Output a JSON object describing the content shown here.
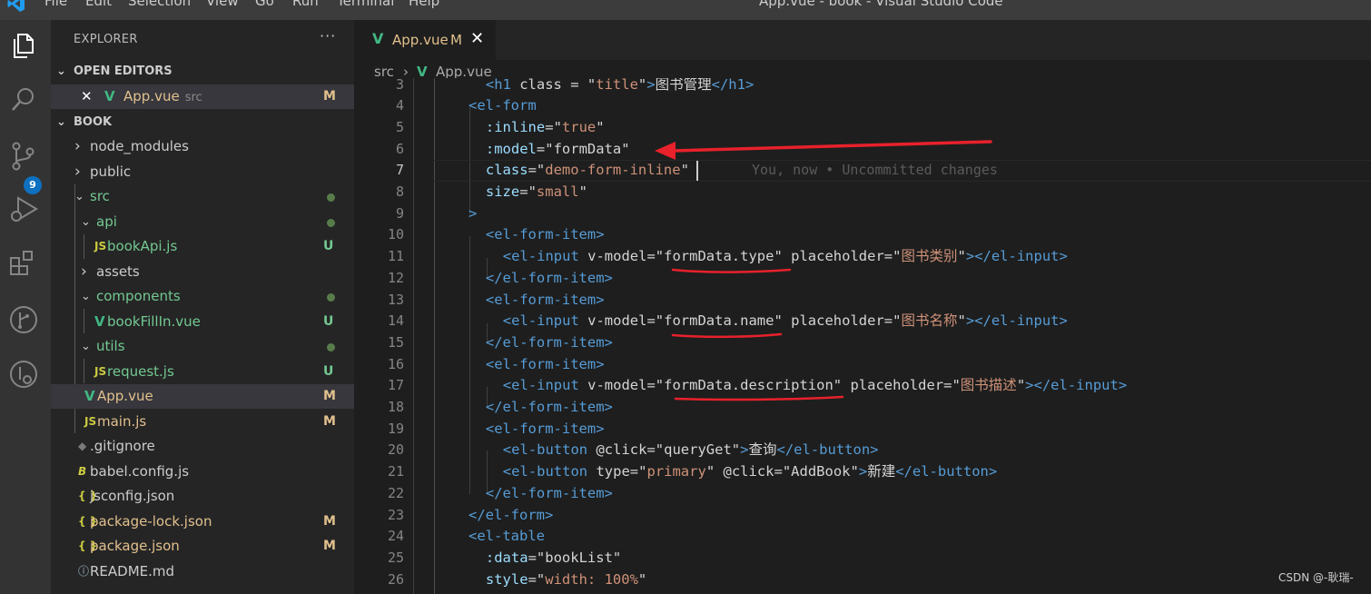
{
  "window": {
    "title": "App.vue - book - Visual Studio Code"
  },
  "menu": [
    "File",
    "Edit",
    "Selection",
    "View",
    "Go",
    "Run",
    "Terminal",
    "Help"
  ],
  "activity": {
    "source_control_badge": "9"
  },
  "explorer": {
    "title": "EXPLORER",
    "more": "···",
    "open_editors_title": "OPEN EDITORS",
    "open_editor": {
      "name": "App.vue",
      "folder": "src",
      "status": "M"
    },
    "project_title": "BOOK",
    "items": [
      {
        "name": "node_modules",
        "kind": "folder",
        "status": ""
      },
      {
        "name": "public",
        "kind": "folder",
        "status": ""
      },
      {
        "name": "src",
        "kind": "folder",
        "status": "dot"
      },
      {
        "name": "api",
        "kind": "folder",
        "status": "dot"
      },
      {
        "name": "bookApi.js",
        "kind": "js",
        "status": "U"
      },
      {
        "name": "assets",
        "kind": "folder",
        "status": ""
      },
      {
        "name": "components",
        "kind": "folder",
        "status": "dot"
      },
      {
        "name": "bookFillIn.vue",
        "kind": "vue",
        "status": "U"
      },
      {
        "name": "utils",
        "kind": "folder",
        "status": "dot"
      },
      {
        "name": "request.js",
        "kind": "js",
        "status": "U"
      },
      {
        "name": "App.vue",
        "kind": "vue",
        "status": "M"
      },
      {
        "name": "main.js",
        "kind": "js",
        "status": "M"
      },
      {
        "name": ".gitignore",
        "kind": "git",
        "status": ""
      },
      {
        "name": "babel.config.js",
        "kind": "babel",
        "status": ""
      },
      {
        "name": "jsconfig.json",
        "kind": "json",
        "status": ""
      },
      {
        "name": "package-lock.json",
        "kind": "json",
        "status": "M"
      },
      {
        "name": "package.json",
        "kind": "json",
        "status": "M"
      },
      {
        "name": "README.md",
        "kind": "info",
        "status": ""
      }
    ]
  },
  "tab": {
    "name": "App.vue",
    "status": "M",
    "close": "✕"
  },
  "breadcrumb": {
    "folder": "src",
    "sep": "›",
    "file": "App.vue"
  },
  "editor": {
    "blame": "You, now • Uncommitted changes",
    "line_numbers": [
      "3",
      "4",
      "5",
      "6",
      "7",
      "8",
      "9",
      "10",
      "11",
      "12",
      "13",
      "14",
      "15",
      "16",
      "17",
      "18",
      "19",
      "20",
      "21",
      "22",
      "23",
      "24",
      "25",
      "26"
    ],
    "lines": [
      "<h1 class = \"title\">图书管理</h1>",
      "<el-form",
      ":inline=\"true\"",
      ":model=\"formData\"",
      "class=\"demo-form-inline\"",
      "size=\"small\"",
      ">",
      "<el-form-item>",
      "<el-input v-model=\"formData.type\" placeholder=\"图书类别\"></el-input>",
      "</el-form-item>",
      "<el-form-item>",
      "<el-input v-model=\"formData.name\" placeholder=\"图书名称\"></el-input>",
      "</el-form-item>",
      "<el-form-item>",
      "<el-input v-model=\"formData.description\" placeholder=\"图书描述\"></el-input>",
      "</el-form-item>",
      "<el-form-item>",
      "<el-button @click=\"queryGet\">查询</el-button>",
      "<el-button type=\"primary\" @click=\"AddBook\">新建</el-button>",
      "</el-form-item>",
      "</el-form>",
      "<el-table",
      ":data=\"bookList\"",
      "style=\"width: 100%\""
    ]
  },
  "colors": {
    "annotation": "#e8212b",
    "vue": "#41b883",
    "js": "#cbcb41",
    "modified": "#e2c08d",
    "untracked": "#73c991"
  },
  "watermark": "CSDN @-耿瑞-"
}
